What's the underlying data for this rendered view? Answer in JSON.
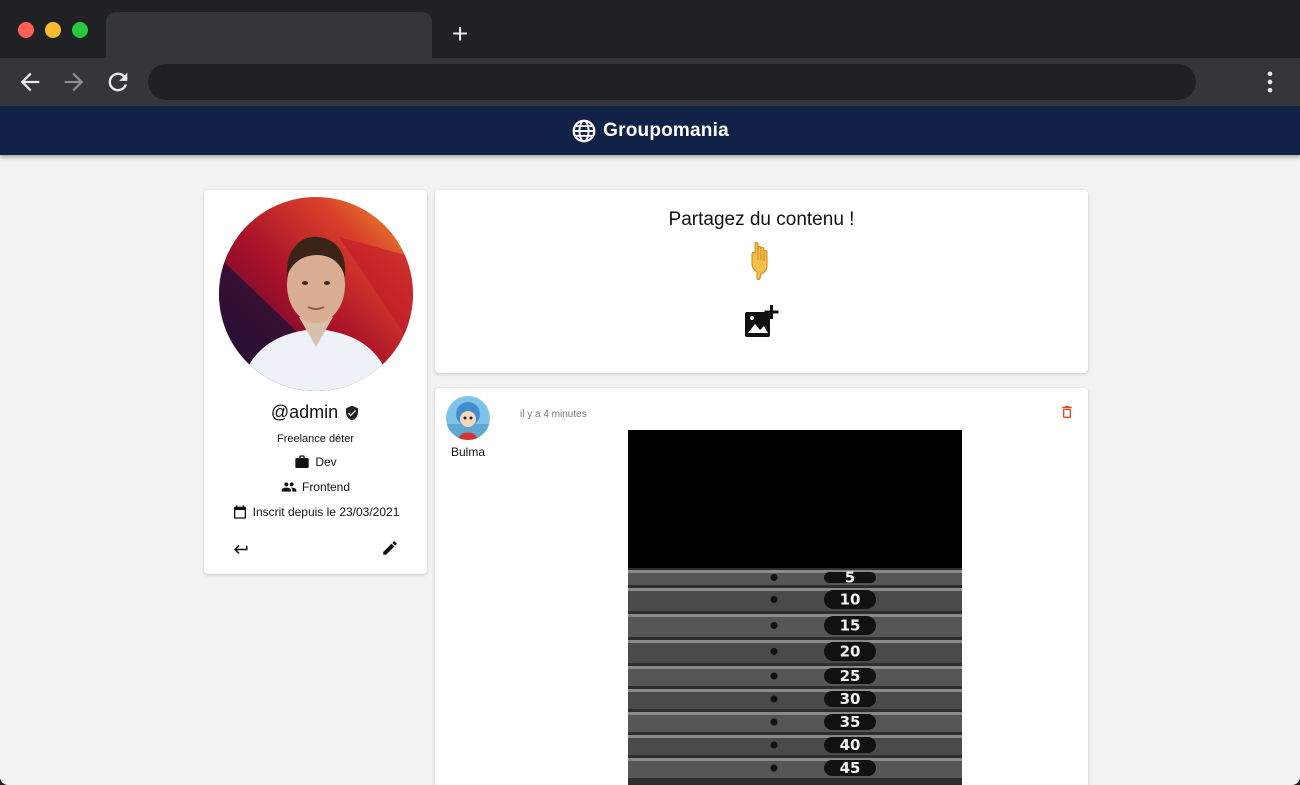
{
  "browser": {
    "new_tab_label": "+",
    "back_icon": "arrow-left-icon",
    "forward_icon": "arrow-right-icon",
    "reload_icon": "reload-icon",
    "menu_icon": "kebab-menu-icon"
  },
  "app": {
    "brand_name": "Groupomania",
    "brand_icon": "globe-icon",
    "navbar_color": "#122148"
  },
  "profile": {
    "username": "@admin",
    "title": "Freelance déter",
    "job": "Dev",
    "team": "Frontend",
    "member_since": "Inscrit depuis le 23/03/2021"
  },
  "share": {
    "title": "Partagez du contenu !",
    "emoji": "pointing-down-hand-icon"
  },
  "post": {
    "author": "Bulma",
    "time": "il y a 4 minutes",
    "delete_color": "#e64a19",
    "weight_labels": [
      "5",
      "10",
      "15",
      "20",
      "25",
      "30",
      "35",
      "40",
      "45"
    ]
  }
}
